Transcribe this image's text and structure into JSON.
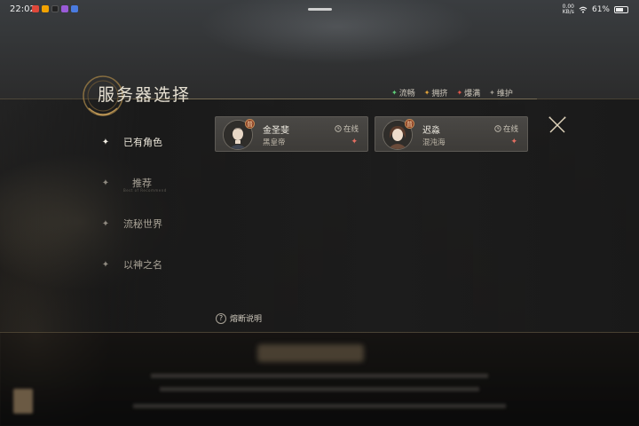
{
  "status_bar": {
    "time": "22:02",
    "network_speed_value": "0.00",
    "network_speed_unit": "KB/s",
    "battery": "61%"
  },
  "panel": {
    "title": "服务器选择",
    "legend": [
      {
        "label": "流畅",
        "color": "#5fd07a"
      },
      {
        "label": "拥挤",
        "color": "#e0a23a"
      },
      {
        "label": "爆满",
        "color": "#e0564a"
      },
      {
        "label": "维护",
        "color": "#9a968d"
      }
    ]
  },
  "sidebar": {
    "items": [
      {
        "label": "已有角色",
        "active": true
      },
      {
        "label": "推荐",
        "sub": "Best of Recommend",
        "active": false
      },
      {
        "label": "流秘世界",
        "sub": "",
        "active": false
      },
      {
        "label": "以神之名",
        "active": false
      }
    ]
  },
  "characters": [
    {
      "name": "金圣斐",
      "server": "黑皇帝",
      "status": "在线",
      "badge": "普",
      "load_color": "#e56f62"
    },
    {
      "name": "迟淼",
      "server": "混沌海",
      "status": "在线",
      "badge": "普",
      "load_color": "#e56f62"
    }
  ],
  "help": {
    "label": "熔断说明",
    "icon": "question-icon"
  },
  "colors": {
    "accent": "#c8a86a",
    "card_bg": "#44423f"
  }
}
